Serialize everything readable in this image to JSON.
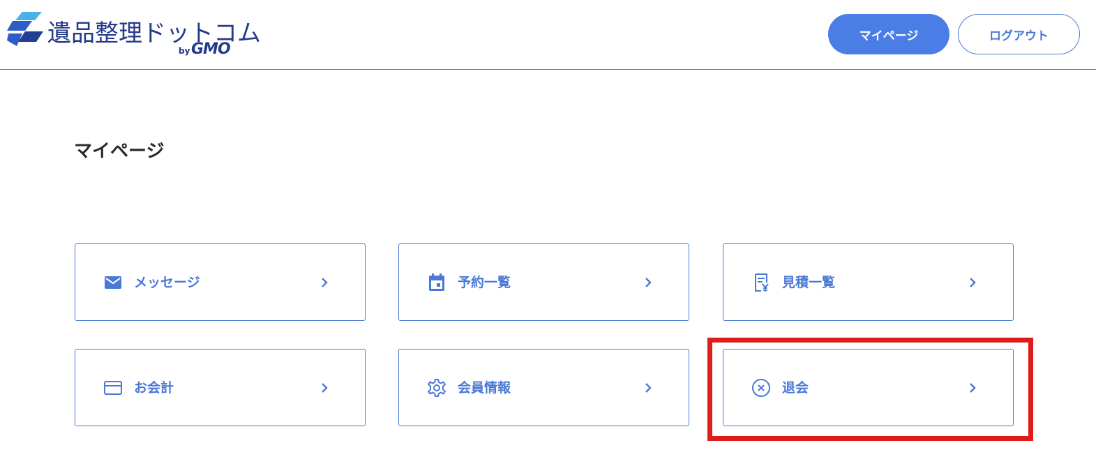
{
  "header": {
    "logo_text": "遺品整理ドットコム",
    "logo_by": "by",
    "logo_brand": "GMO",
    "mypage_button": "マイページ",
    "logout_button": "ログアウト"
  },
  "page": {
    "title": "マイページ"
  },
  "menu": {
    "items": [
      {
        "label": "メッセージ",
        "icon": "mail-icon"
      },
      {
        "label": "予約一覧",
        "icon": "calendar-icon"
      },
      {
        "label": "見積一覧",
        "icon": "receipt-yen-icon"
      },
      {
        "label": "お会計",
        "icon": "credit-card-icon"
      },
      {
        "label": "会員情報",
        "icon": "gear-icon"
      },
      {
        "label": "退会",
        "icon": "circle-x-icon"
      }
    ]
  },
  "colors": {
    "accent": "#4a78d6",
    "primary_button": "#4a7ee6",
    "logo": "#243a8a",
    "highlight": "#e01b1b"
  }
}
